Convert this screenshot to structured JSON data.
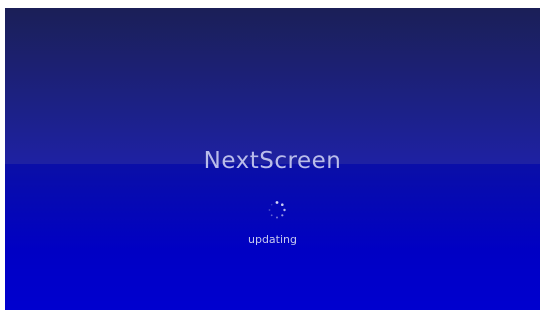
{
  "app": {
    "title": "NextScreen",
    "status": "updating"
  },
  "icons": {
    "loading": "loading-spinner-icon"
  },
  "colors": {
    "background_top": "#1b1f57",
    "background_band": "#1e21a3",
    "background_bottom": "#0000cf",
    "text": "#b9bcea"
  }
}
